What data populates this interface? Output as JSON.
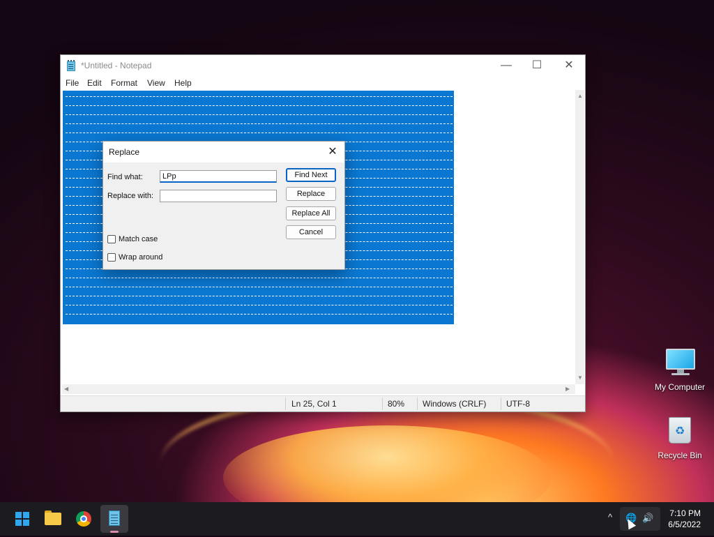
{
  "notepad": {
    "title": "*Untitled - Notepad",
    "window_controls": {
      "minimize": "—",
      "maximize": "☐",
      "close": "✕"
    },
    "menu": [
      "File",
      "Edit",
      "Format",
      "View",
      "Help"
    ],
    "status": {
      "position": "Ln 25, Col 1",
      "zoom": "80%",
      "line_ending": "Windows (CRLF)",
      "encoding": "UTF-8"
    }
  },
  "replace_dialog": {
    "title": "Replace",
    "close_glyph": "✕",
    "find_label": "Find what:",
    "find_value": "LPp",
    "replace_label": "Replace with:",
    "replace_value": "",
    "buttons": {
      "find_next": "Find Next",
      "replace": "Replace",
      "replace_all": "Replace All",
      "cancel": "Cancel"
    },
    "match_case_label": "Match case",
    "match_case_checked": false,
    "wrap_around_label": "Wrap around",
    "wrap_around_checked": false
  },
  "desktop": {
    "icons": [
      {
        "label": "My Computer",
        "icon": "monitor-icon"
      },
      {
        "label": "Recycle Bin",
        "icon": "recycle-bin-icon"
      }
    ]
  },
  "taskbar": {
    "apps": [
      "start-icon",
      "file-explorer-icon",
      "chrome-icon",
      "notepad-icon"
    ],
    "active_app": "notepad-icon",
    "tray": {
      "chevron": "^",
      "network": "🌐",
      "volume": "🔊"
    },
    "time": "7:10 PM",
    "date": "6/5/2022"
  },
  "colors": {
    "selection": "#0a78d2",
    "accent": "#0a64c8",
    "taskbar": "#1c1c20"
  }
}
